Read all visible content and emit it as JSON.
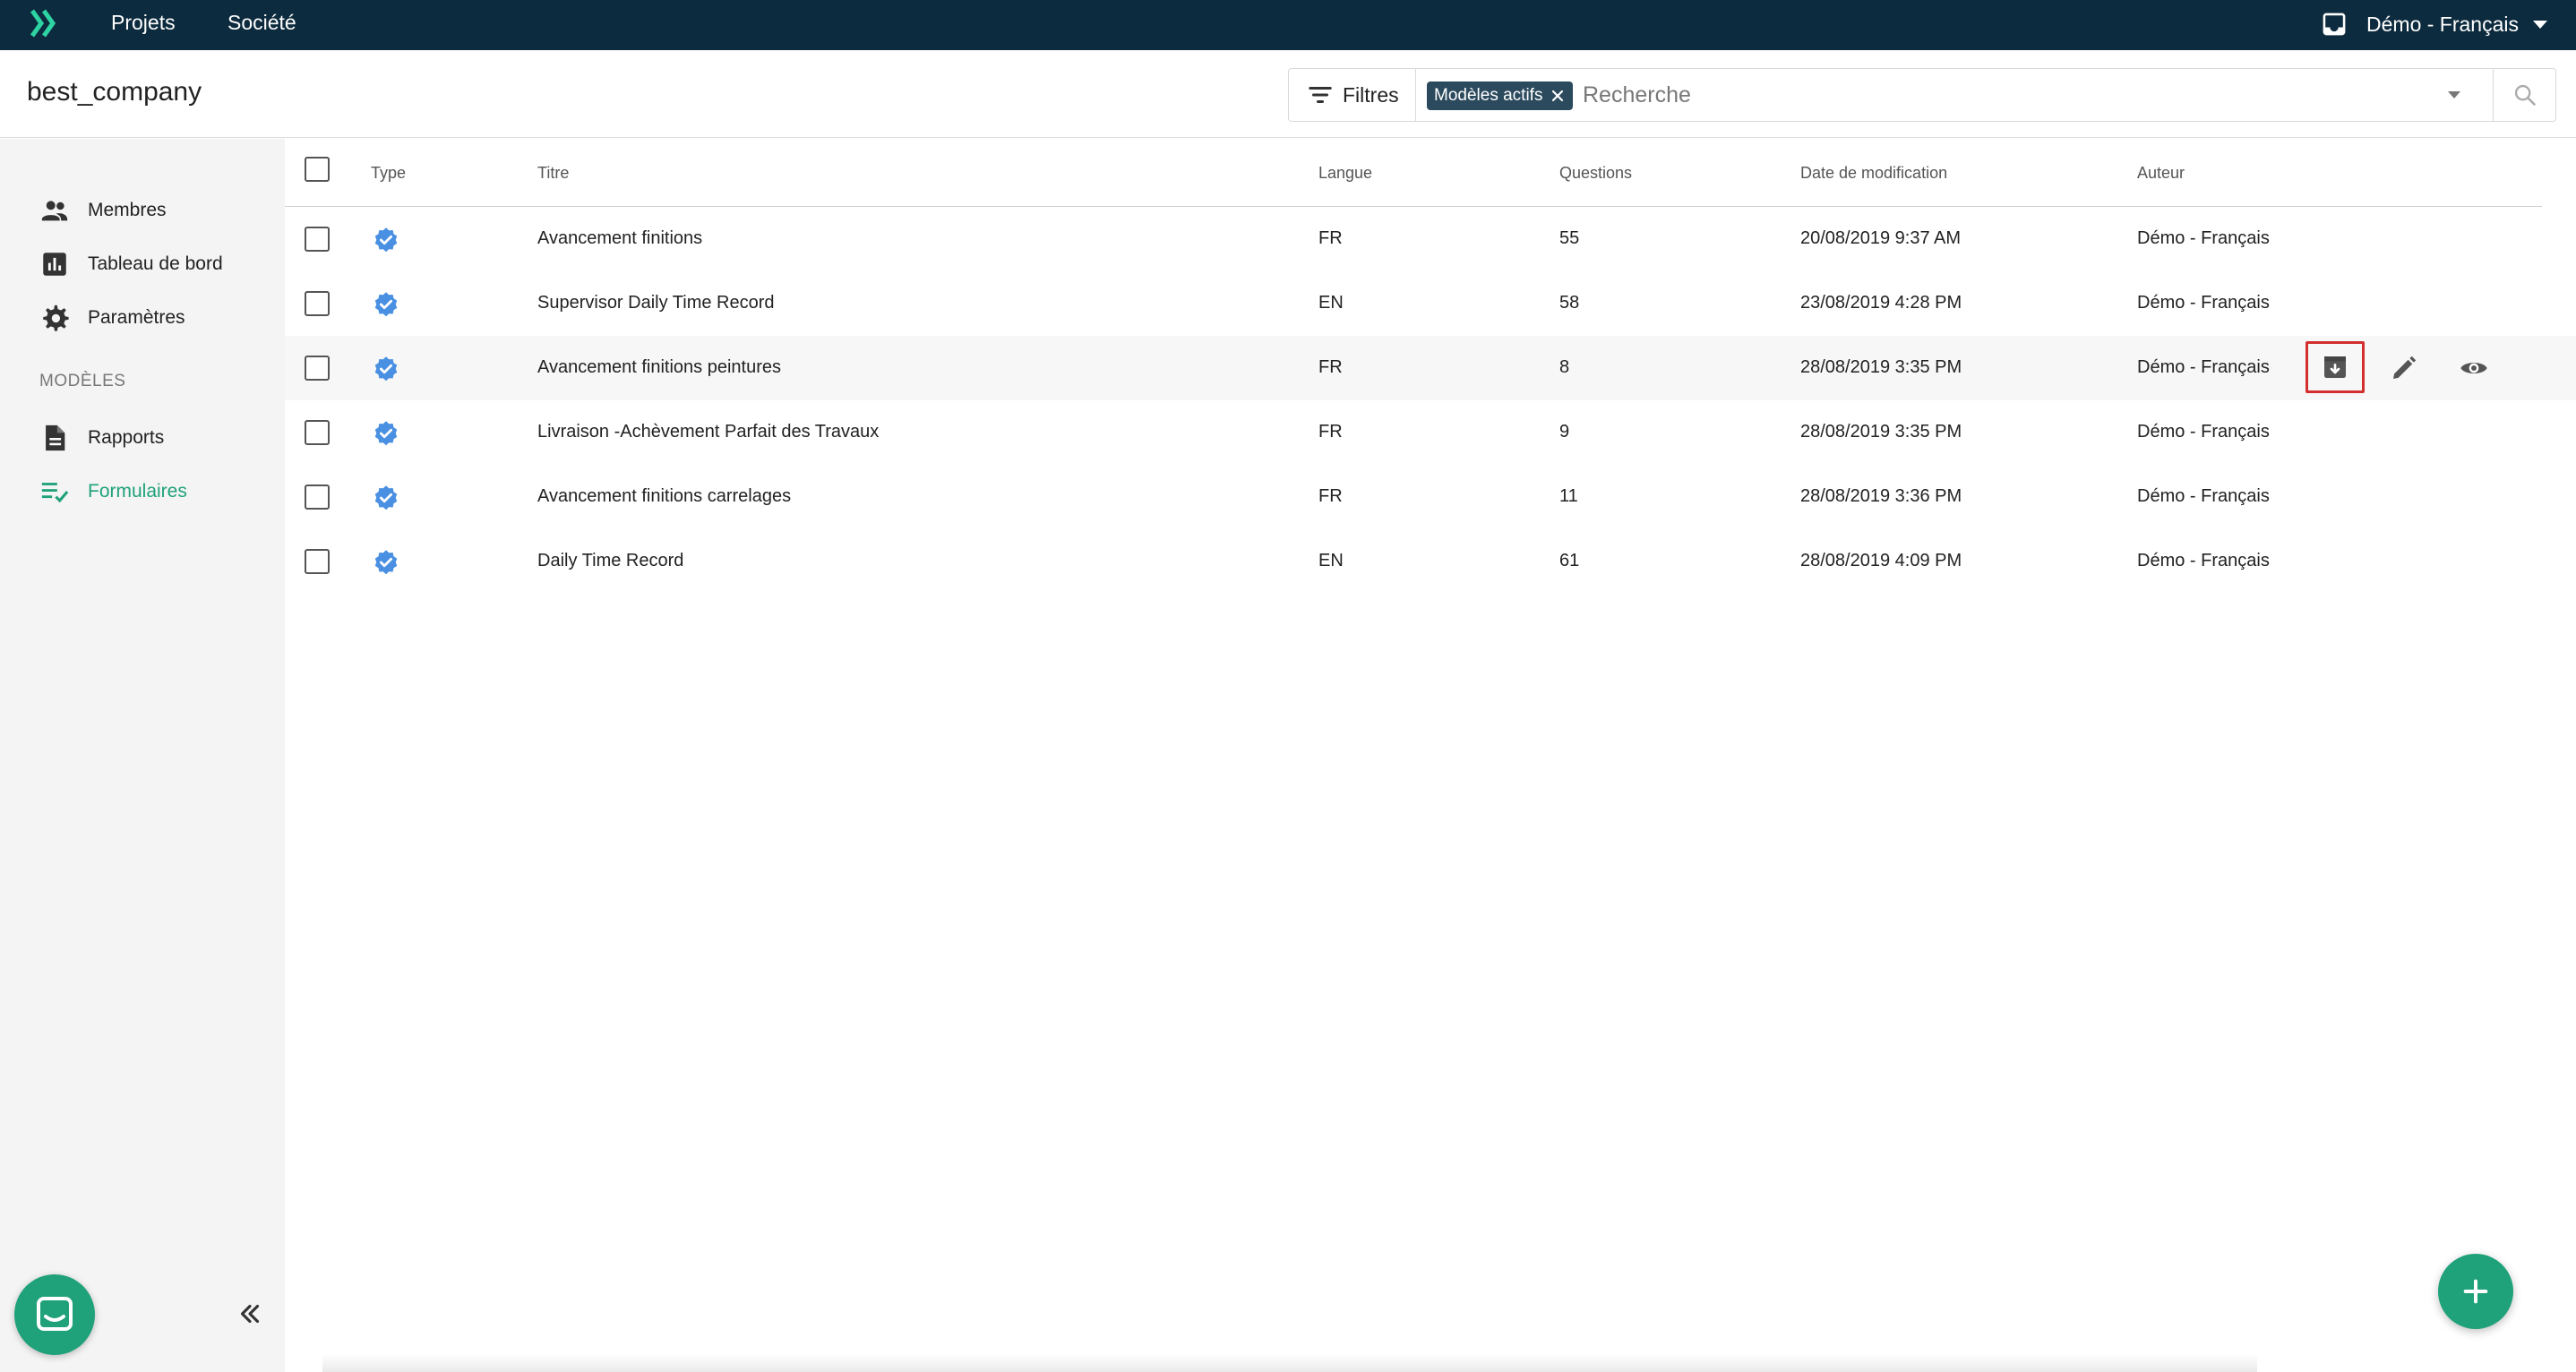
{
  "topbar": {
    "logo_icon": "chevron-logo-icon",
    "nav": [
      {
        "label": "Projets"
      },
      {
        "label": "Société"
      }
    ],
    "user": {
      "label": "Démo - Français",
      "icon": "inbox-icon"
    }
  },
  "header": {
    "company": "best_company",
    "filter_label": "Filtres",
    "active_chip": "Modèles actifs",
    "search_placeholder": "Recherche"
  },
  "sidebar": {
    "items": [
      {
        "label": "Membres",
        "icon": "people-icon"
      },
      {
        "label": "Tableau de bord",
        "icon": "bar-chart-icon"
      },
      {
        "label": "Paramètres",
        "icon": "gear-icon"
      }
    ],
    "section_label": "MODÈLES",
    "model_items": [
      {
        "label": "Rapports",
        "icon": "document-icon"
      },
      {
        "label": "Formulaires",
        "icon": "checklist-icon",
        "active": true
      }
    ]
  },
  "table": {
    "headers": {
      "type": "Type",
      "title": "Titre",
      "lang": "Langue",
      "questions": "Questions",
      "modified": "Date de modification",
      "author": "Auteur"
    },
    "rows": [
      {
        "title": "Avancement finitions",
        "lang": "FR",
        "questions": "55",
        "modified": "20/08/2019 9:37 AM",
        "author": "Démo - Français"
      },
      {
        "title": "Supervisor Daily Time Record",
        "lang": "EN",
        "questions": "58",
        "modified": "23/08/2019 4:28 PM",
        "author": "Démo - Français"
      },
      {
        "title": "Avancement finitions peintures",
        "lang": "FR",
        "questions": "8",
        "modified": "28/08/2019 3:35 PM",
        "author": "Démo - Français"
      },
      {
        "title": "Livraison -Achèvement Parfait des Travaux",
        "lang": "FR",
        "questions": "9",
        "modified": "28/08/2019 3:35 PM",
        "author": "Démo - Français"
      },
      {
        "title": "Avancement finitions carrelages",
        "lang": "FR",
        "questions": "11",
        "modified": "28/08/2019 3:36 PM",
        "author": "Démo - Français"
      },
      {
        "title": "Daily Time Record",
        "lang": "EN",
        "questions": "61",
        "modified": "28/08/2019 4:09 PM",
        "author": "Démo - Français"
      }
    ],
    "hover_row_index": 2,
    "row_actions": [
      "archive-icon",
      "pencil-icon",
      "eye-icon"
    ]
  },
  "colors": {
    "topbar": "#0d2b3e",
    "accent": "#1fa17a",
    "badge": "#4a90e2",
    "chip": "#2c4a5e",
    "highlight": "#d32f2f"
  }
}
